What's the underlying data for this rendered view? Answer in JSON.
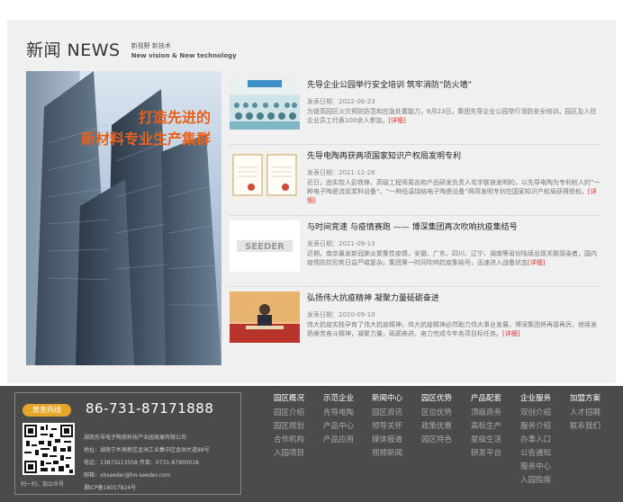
{
  "news": {
    "title": "新闻 NEWS",
    "subtitle_cn": "新视野 新技术",
    "subtitle_en": "New vision & New technology",
    "feature": {
      "slogan_line1": "打造先进的",
      "slogan_line2": "新材料专业生产集群"
    },
    "items": [
      {
        "title": "先导企业公园举行安全培训 筑牢消防“防火墙”",
        "date": "发表日期：2022-06-23",
        "desc": "为提高园区火灾预防防范和应急处置能力，6月23日，集团先导企业公园举行消防安全培训，园区及入驻企业员工代表100余人参加。",
        "more": "[详细]"
      },
      {
        "title": "先导电陶再获两项国家知识产权局发明专利",
        "date": "发表日期：2021-11-26",
        "desc": "近日，由实控人彭铁锋、高级工程师周吉和产品研发负责人毛宇联袂发明的，以先导电陶为专利权人的“一种电子陶瓷流延浆料设备”、“一种低温烧结电子陶瓷设备”两项发明专利在国家知识产权局获得授权。",
        "more": "[详细]"
      },
      {
        "title": "与时间竞速 与疫情赛跑 —— 博深集团再次吹响抗疫集结号",
        "date": "发表日期：2021-09-13",
        "desc": "近期，南京暴发新冠肺炎聚集性疫情，安徽、广东、四川、辽宁、湖南等省份陆续出现关联感染者，国内疫情防控形势日益严峻复杂。集团第一时间吹响抗疫集结号，迅速进入战备状态",
        "more": "[详细]",
        "thumb_text": "SEEDER"
      },
      {
        "title": "弘扬伟大抗疫精神 凝聚力量砥砺奋进",
        "date": "发表日期：2020-09-10",
        "desc": "伟大抗疫实践孕育了伟大抗疫精神，伟大抗疫精神必然助力伟大事业发展，博深集团将再接再厉，继续发扬艰苦奋斗精神，凝聚力量，砥砺奋进，奋力完成今年各项目标任务。",
        "more": "[详细]"
      }
    ]
  },
  "footer": {
    "hotline_label": "黄金热线",
    "hotline_phone": "86-731-87171888",
    "company": "湖南先导电子陶瓷科技产业园发展有限公司",
    "address": "地址：湖南宁乡高新区金洲工业集中区金洲大道88号",
    "phone": "电话：13873213558 传真：0731-87900018",
    "email": "邮箱：xbseeder@hn-seeder.com",
    "icp": "湘ICP备18017824号",
    "qr_caption": "扫一扫，加公众号",
    "nav": [
      {
        "head": "园区概况",
        "links": [
          "园区介绍",
          "园区规划",
          "合作机构",
          "入园项目"
        ]
      },
      {
        "head": "示范企业",
        "links": [
          "先导电陶",
          "产品中心",
          "产品应用"
        ]
      },
      {
        "head": "新闻中心",
        "links": [
          "园区资讯",
          "领导关怀",
          "媒体报道",
          "视频新闻"
        ]
      },
      {
        "head": "园区优势",
        "links": [
          "区位优势",
          "政策优惠",
          "园区特色"
        ]
      },
      {
        "head": "产品配套",
        "links": [
          "顶级商务",
          "高标生产",
          "星级生活",
          "研发平台"
        ]
      },
      {
        "head": "企业服务",
        "links": [
          "双创介绍",
          "服务介绍",
          "办事入口",
          "公告通知",
          "服务中心",
          "入园指南"
        ]
      },
      {
        "head": "加盟方案",
        "links": [
          "人才招聘",
          "联系我们"
        ]
      }
    ]
  },
  "colors": {
    "accent": "#e8611a",
    "more_link": "#d0332e",
    "hotline_badge": "#e7a52a",
    "footer_bg": "#4b4b4b",
    "news_bg": "#f0f0f0"
  }
}
